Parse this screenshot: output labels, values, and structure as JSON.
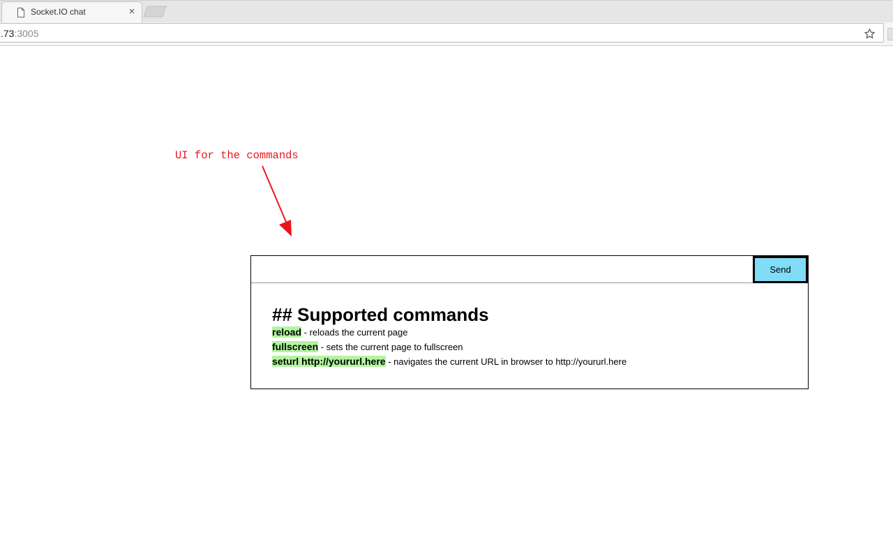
{
  "browser": {
    "tab_title": "Socket.IO chat",
    "tab_close": "×",
    "url_host": ".73",
    "url_port": ":3005"
  },
  "annotation": {
    "text": "UI for the commands",
    "color": "#e8161c"
  },
  "chat": {
    "input_value": "",
    "send_label": "Send",
    "send_color": "#81dcf7",
    "heading": "## Supported commands",
    "commands": [
      {
        "name": "reload",
        "description": " - reloads the current page"
      },
      {
        "name": "fullscreen",
        "description": " - sets the current page to fullscreen"
      },
      {
        "name": "seturl http://yoururl.here",
        "description": " - navigates the current URL in browser to http://yoururl.here"
      }
    ],
    "highlight_color": "#b3f59e"
  },
  "icons": {
    "tab": "page-icon",
    "bookmark": "star-icon"
  }
}
